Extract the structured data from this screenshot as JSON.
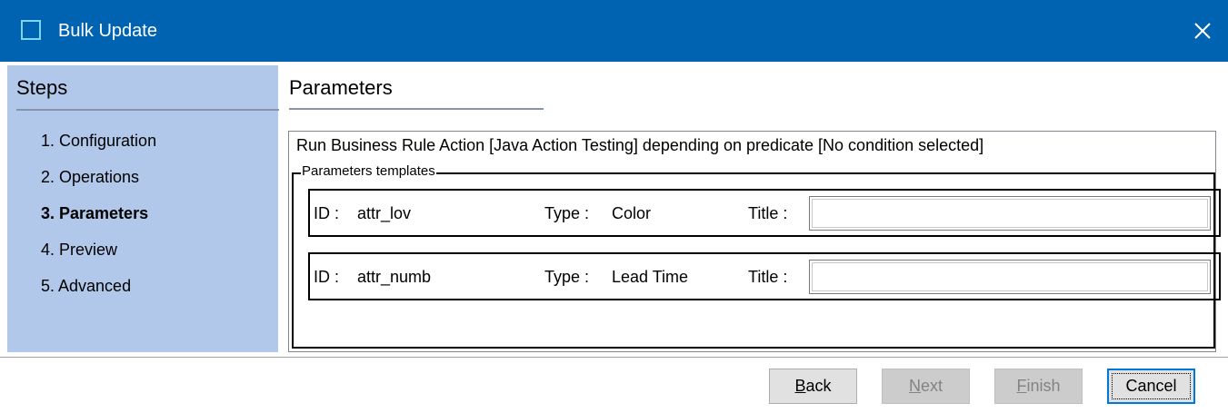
{
  "window": {
    "title": "Bulk Update",
    "close_symbol": "✕"
  },
  "sidebar": {
    "header": "Steps",
    "items": [
      {
        "label": "1. Configuration",
        "active": false
      },
      {
        "label": "2. Operations",
        "active": false
      },
      {
        "label": "3. Parameters",
        "active": true
      },
      {
        "label": "4. Preview",
        "active": false
      },
      {
        "label": "5. Advanced",
        "active": false
      }
    ]
  },
  "main": {
    "title": "Parameters",
    "description": "Run Business Rule Action [Java Action Testing] depending on predicate  [No condition selected]",
    "group_label": "Parameters templates",
    "rows": [
      {
        "id_label": "ID :",
        "id_value": "attr_lov",
        "type_label": "Type :",
        "type_value": "Color",
        "title_label": "Title :",
        "title_value": ""
      },
      {
        "id_label": "ID :",
        "id_value": "attr_numb",
        "type_label": "Type :",
        "type_value": "Lead Time",
        "title_label": "Title :",
        "title_value": ""
      }
    ]
  },
  "footer": {
    "back_label": "Back",
    "next_label": "Next",
    "finish_label": "Finish",
    "cancel_label": "Cancel"
  },
  "colors": {
    "titlebar": "#0063b1",
    "sidebar": "#b1c8ea",
    "accent": "#0078d7"
  }
}
